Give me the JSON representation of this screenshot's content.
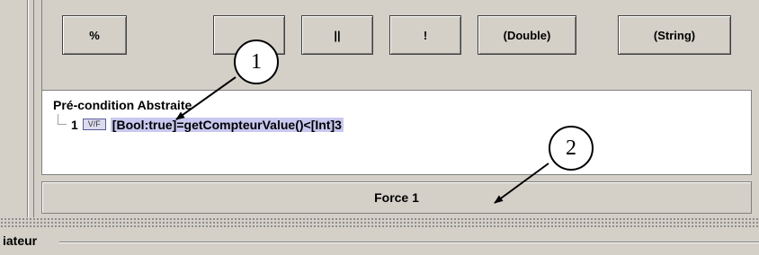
{
  "operator_buttons": [
    {
      "label": "%"
    },
    {
      "label": ""
    },
    {
      "label": "||"
    },
    {
      "label": "!"
    },
    {
      "label": "(Double)"
    },
    {
      "label": "(String)"
    }
  ],
  "tree": {
    "root_label": "Pré-condition Abstraite",
    "node": {
      "number": "1",
      "icon_text": "V/F",
      "expression": "[Bool:true]=getCompteurValue()<[Int]3"
    }
  },
  "force_button": {
    "label": "Force 1"
  },
  "bottom_section": {
    "label": "iateur"
  },
  "callouts": [
    {
      "label": "1"
    },
    {
      "label": "2"
    }
  ]
}
